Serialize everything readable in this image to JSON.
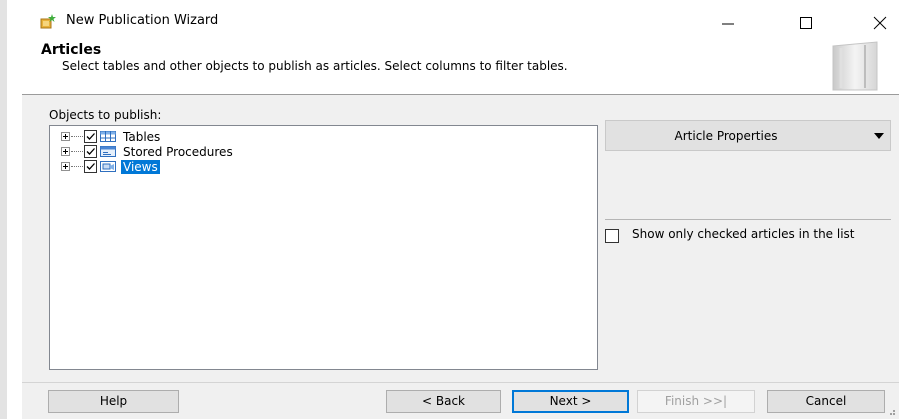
{
  "window": {
    "title": "New Publication Wizard",
    "icon": "wizard-icon"
  },
  "header": {
    "title": "Articles",
    "subtitle": "Select tables and other objects to publish as articles. Select columns to filter tables."
  },
  "objects": {
    "label": "Objects to publish:",
    "items": [
      {
        "label": "Tables",
        "checked": true,
        "icon": "table-icon",
        "selected": false
      },
      {
        "label": "Stored Procedures",
        "checked": true,
        "icon": "stored-procedure-icon",
        "selected": false
      },
      {
        "label": "Views",
        "checked": true,
        "icon": "view-icon",
        "selected": true
      }
    ]
  },
  "article_properties": {
    "label": "Article Properties"
  },
  "show_only_checked": {
    "label": "Show only checked articles in the list",
    "checked": false
  },
  "footer": {
    "help": "Help",
    "back": "< Back",
    "next": "Next >",
    "finish": "Finish >>|",
    "cancel": "Cancel"
  },
  "colors": {
    "accent": "#0078d7",
    "body_bg": "#f0f0f0",
    "button_bg": "#e1e1e1"
  }
}
